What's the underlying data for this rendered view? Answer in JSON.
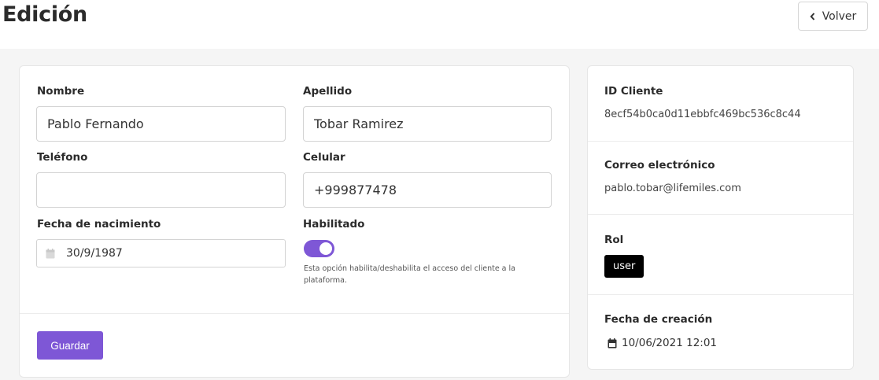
{
  "header": {
    "title": "Edición",
    "back_label": "Volver"
  },
  "form": {
    "nombre_label": "Nombre",
    "nombre_value": "Pablo Fernando",
    "apellido_label": "Apellido",
    "apellido_value": "Tobar Ramirez",
    "telefono_label": "Teléfono",
    "telefono_value": "",
    "celular_label": "Celular",
    "celular_value": "+999877478",
    "fecha_label": "Fecha de nacimiento",
    "fecha_value": "30/9/1987",
    "habilitado_label": "Habilitado",
    "habilitado_on": true,
    "habilitado_hint": "Esta opción habilita/deshabilita el acceso del cliente a la plataforma.",
    "save_label": "Guardar"
  },
  "info": {
    "id_label": "ID Cliente",
    "id_value": "8ecf54b0ca0d11ebbfc469bc536c8c44",
    "email_label": "Correo electrónico",
    "email_value": "pablo.tobar@lifemiles.com",
    "rol_label": "Rol",
    "rol_value": "user",
    "created_label": "Fecha de creación",
    "created_value": "10/06/2021 12:01"
  },
  "colors": {
    "accent": "#7e57d6",
    "badge": "#000000"
  }
}
